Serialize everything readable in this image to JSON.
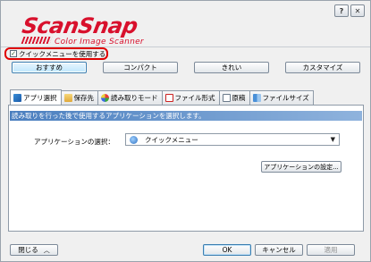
{
  "window": {
    "title_buttons": [
      {
        "label": "?",
        "icon": "help-icon"
      },
      {
        "label": "✕",
        "icon": "close-icon"
      }
    ]
  },
  "logo": {
    "brand": "ScanSnap",
    "tagline": "Color Image Scanner",
    "color": "#d8102c"
  },
  "quick_menu": {
    "checked": true,
    "label": "クイックメニューを使用する"
  },
  "presets": [
    {
      "label": "おすすめ",
      "selected": true
    },
    {
      "label": "コンパクト",
      "selected": false
    },
    {
      "label": "きれい",
      "selected": false
    },
    {
      "label": "カスタマイズ",
      "selected": false
    }
  ],
  "tabs": [
    {
      "label": "アプリ選択",
      "icon": "app-select-icon",
      "active": true
    },
    {
      "label": "保存先",
      "icon": "folder-icon",
      "active": false
    },
    {
      "label": "読み取りモード",
      "icon": "scan-mode-icon",
      "active": false
    },
    {
      "label": "ファイル形式",
      "icon": "file-format-icon",
      "active": false
    },
    {
      "label": "原稿",
      "icon": "document-icon",
      "active": false
    },
    {
      "label": "ファイルサイズ",
      "icon": "file-size-icon",
      "active": false
    }
  ],
  "panel": {
    "header": "読み取りを行った後で使用するアプリケーションを選択します。",
    "app_label": "アプリケーションの選択：",
    "app_value": "クイックメニュー",
    "app_settings_button": "アプリケーションの設定..."
  },
  "footer": {
    "close_label": "閉じる",
    "close_chevron": "︿",
    "ok_label": "OK",
    "cancel_label": "キャンセル",
    "apply_label": "適用"
  },
  "colors": {
    "header_blue": "#4b7fbf",
    "highlight_red": "#e00000",
    "selected_button": "#bee6fd"
  }
}
